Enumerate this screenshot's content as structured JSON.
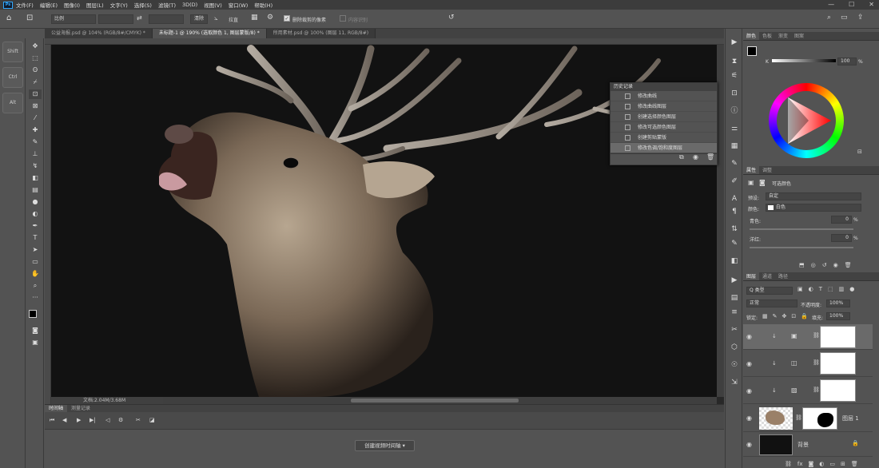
{
  "app": {
    "logo": "Ps"
  },
  "menu": [
    "文件(F)",
    "编辑(E)",
    "图像(I)",
    "图层(L)",
    "文字(Y)",
    "选择(S)",
    "滤镜(T)",
    "3D(D)",
    "视图(V)",
    "窗口(W)",
    "帮助(H)"
  ],
  "window_controls": {
    "minimize": "—",
    "maximize": "☐",
    "close": "✕"
  },
  "options": {
    "ratio_value": "比例",
    "clear_label": "清除",
    "straighten_label": "拉直",
    "delete_cropped_label": "删除裁剪的像素",
    "content_aware_label": "内容识别",
    "delete_cropped_checked": true
  },
  "doc_tabs": [
    {
      "label": "公益海报.psd @ 104% (RGB/8#/CMYK) *",
      "active": false
    },
    {
      "label": "未标题-1 @ 190% (选取颜色 1, 图层蒙版/8) *",
      "active": true
    },
    {
      "label": "所用素材.psd @ 100% (图层 11, RGB/8#)",
      "active": false
    }
  ],
  "modifier_keys": [
    "Shift",
    "Ctrl",
    "Alt"
  ],
  "status": {
    "doc_info": "文档:2.04M/3.68M"
  },
  "history": {
    "title": "历史记录",
    "items": [
      {
        "label": "修改曲线",
        "selected": false
      },
      {
        "label": "修改曲线图层",
        "selected": false
      },
      {
        "label": "创建选择颜色图层",
        "selected": false
      },
      {
        "label": "修改可选颜色图层",
        "selected": false
      },
      {
        "label": "创建剪贴蒙版",
        "selected": false
      },
      {
        "label": "修改色调/饱和度图层",
        "selected": true
      }
    ]
  },
  "timeline": {
    "tabs": [
      {
        "label": "时间轴",
        "active": true
      },
      {
        "label": "测量记录",
        "active": false
      }
    ],
    "create_label": "创建视频时间轴"
  },
  "color_panel": {
    "tabs": [
      {
        "label": "颜色",
        "active": true
      },
      {
        "label": "色板",
        "active": false
      },
      {
        "label": "渐变",
        "active": false
      },
      {
        "label": "图案",
        "active": false
      }
    ],
    "k_label": "K",
    "k_value": "100",
    "k_unit": "%"
  },
  "properties": {
    "tabs": [
      {
        "label": "属性",
        "active": true
      },
      {
        "label": "调整",
        "active": false
      }
    ],
    "title": "可选颜色",
    "preset_label": "预设:",
    "preset_value": "自定",
    "colors_label": "颜色:",
    "colors_value": "白色",
    "cyan_label": "青色:",
    "cyan_value": "0",
    "magenta_label": "洋红:",
    "magenta_value": "0",
    "pct": "%"
  },
  "layers": {
    "tabs": [
      {
        "label": "图层",
        "active": true
      },
      {
        "label": "通道",
        "active": false
      },
      {
        "label": "路径",
        "active": false
      }
    ],
    "filter_label": "Q 类型",
    "blend_mode": "正常",
    "opacity_label": "不透明度:",
    "opacity_value": "100%",
    "lock_label": "锁定:",
    "fill_label": "填充:",
    "fill_value": "100%",
    "items": [
      {
        "name": "",
        "selected": true
      },
      {
        "name": "",
        "selected": false
      },
      {
        "name": "",
        "selected": false
      },
      {
        "name": "图层 1",
        "selected": false
      },
      {
        "name": "背景",
        "selected": false
      }
    ]
  },
  "colors": {
    "ui_bg": "#535353",
    "accent": "#31a8ff"
  }
}
